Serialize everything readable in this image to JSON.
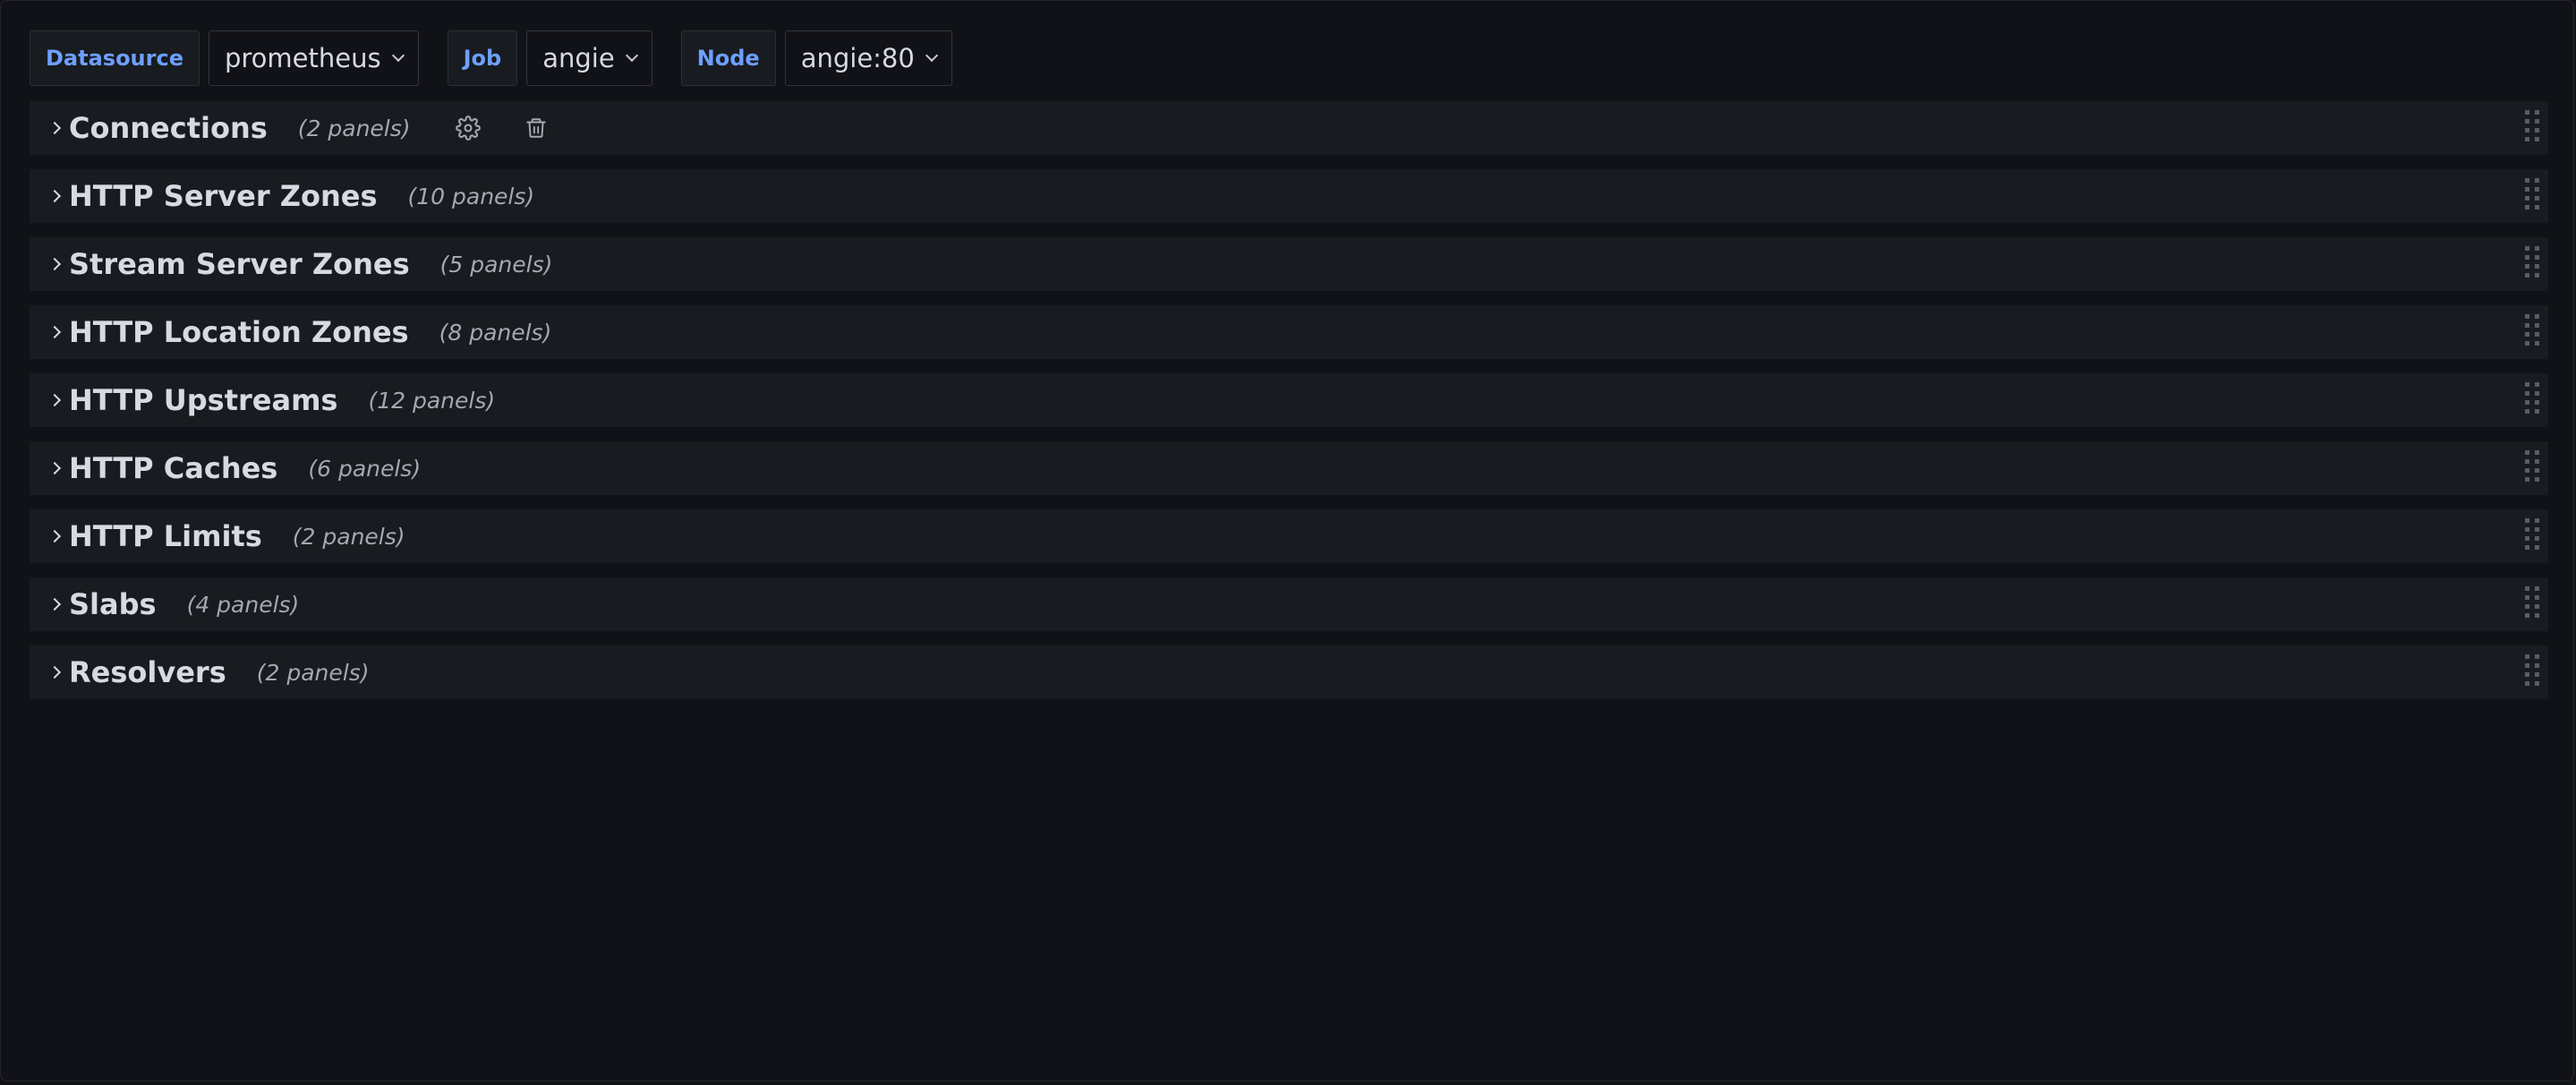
{
  "variables": [
    {
      "label": "Datasource",
      "value": "prometheus"
    },
    {
      "label": "Job",
      "value": "angie"
    },
    {
      "label": "Node",
      "value": "angie:80"
    }
  ],
  "rows": [
    {
      "title": "Connections",
      "count": "(2 panels)",
      "icons": [
        "gear-icon",
        "trash-icon"
      ]
    },
    {
      "title": "HTTP Server Zones",
      "count": "(10 panels)"
    },
    {
      "title": "Stream Server Zones",
      "count": "(5 panels)"
    },
    {
      "title": "HTTP Location Zones",
      "count": "(8 panels)"
    },
    {
      "title": "HTTP Upstreams",
      "count": "(12 panels)"
    },
    {
      "title": "HTTP Caches",
      "count": "(6 panels)"
    },
    {
      "title": "HTTP Limits",
      "count": "(2 panels)"
    },
    {
      "title": "Slabs",
      "count": "(4 panels)"
    },
    {
      "title": "Resolvers",
      "count": "(2 panels)"
    }
  ],
  "colors": {
    "background": "#111217",
    "row_background": "#181b1f",
    "variable_label": "#6e9fff",
    "text": "#d8d9e1",
    "muted_text": "#a6a7b3"
  }
}
